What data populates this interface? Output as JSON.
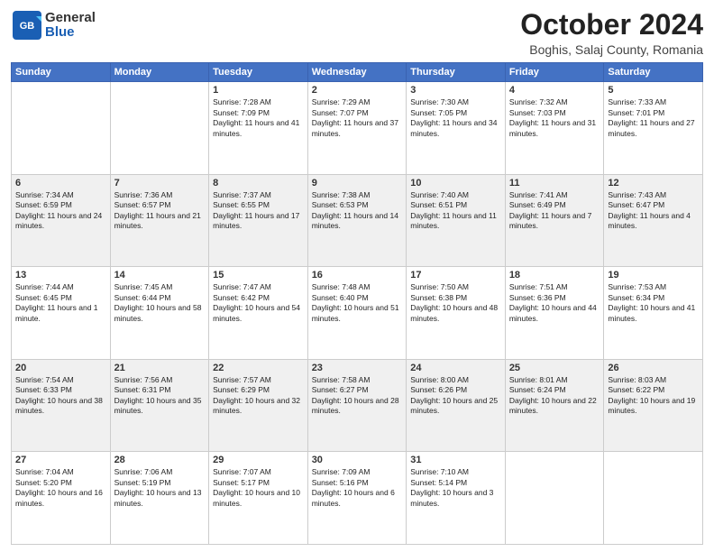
{
  "header": {
    "logo_line1": "General",
    "logo_line2": "Blue",
    "month_title": "October 2024",
    "location": "Boghis, Salaj County, Romania"
  },
  "days_of_week": [
    "Sunday",
    "Monday",
    "Tuesday",
    "Wednesday",
    "Thursday",
    "Friday",
    "Saturday"
  ],
  "weeks": [
    [
      {
        "day": "",
        "content": ""
      },
      {
        "day": "",
        "content": ""
      },
      {
        "day": "1",
        "content": "Sunrise: 7:28 AM\nSunset: 7:09 PM\nDaylight: 11 hours and 41 minutes."
      },
      {
        "day": "2",
        "content": "Sunrise: 7:29 AM\nSunset: 7:07 PM\nDaylight: 11 hours and 37 minutes."
      },
      {
        "day": "3",
        "content": "Sunrise: 7:30 AM\nSunset: 7:05 PM\nDaylight: 11 hours and 34 minutes."
      },
      {
        "day": "4",
        "content": "Sunrise: 7:32 AM\nSunset: 7:03 PM\nDaylight: 11 hours and 31 minutes."
      },
      {
        "day": "5",
        "content": "Sunrise: 7:33 AM\nSunset: 7:01 PM\nDaylight: 11 hours and 27 minutes."
      }
    ],
    [
      {
        "day": "6",
        "content": "Sunrise: 7:34 AM\nSunset: 6:59 PM\nDaylight: 11 hours and 24 minutes."
      },
      {
        "day": "7",
        "content": "Sunrise: 7:36 AM\nSunset: 6:57 PM\nDaylight: 11 hours and 21 minutes."
      },
      {
        "day": "8",
        "content": "Sunrise: 7:37 AM\nSunset: 6:55 PM\nDaylight: 11 hours and 17 minutes."
      },
      {
        "day": "9",
        "content": "Sunrise: 7:38 AM\nSunset: 6:53 PM\nDaylight: 11 hours and 14 minutes."
      },
      {
        "day": "10",
        "content": "Sunrise: 7:40 AM\nSunset: 6:51 PM\nDaylight: 11 hours and 11 minutes."
      },
      {
        "day": "11",
        "content": "Sunrise: 7:41 AM\nSunset: 6:49 PM\nDaylight: 11 hours and 7 minutes."
      },
      {
        "day": "12",
        "content": "Sunrise: 7:43 AM\nSunset: 6:47 PM\nDaylight: 11 hours and 4 minutes."
      }
    ],
    [
      {
        "day": "13",
        "content": "Sunrise: 7:44 AM\nSunset: 6:45 PM\nDaylight: 11 hours and 1 minute."
      },
      {
        "day": "14",
        "content": "Sunrise: 7:45 AM\nSunset: 6:44 PM\nDaylight: 10 hours and 58 minutes."
      },
      {
        "day": "15",
        "content": "Sunrise: 7:47 AM\nSunset: 6:42 PM\nDaylight: 10 hours and 54 minutes."
      },
      {
        "day": "16",
        "content": "Sunrise: 7:48 AM\nSunset: 6:40 PM\nDaylight: 10 hours and 51 minutes."
      },
      {
        "day": "17",
        "content": "Sunrise: 7:50 AM\nSunset: 6:38 PM\nDaylight: 10 hours and 48 minutes."
      },
      {
        "day": "18",
        "content": "Sunrise: 7:51 AM\nSunset: 6:36 PM\nDaylight: 10 hours and 44 minutes."
      },
      {
        "day": "19",
        "content": "Sunrise: 7:53 AM\nSunset: 6:34 PM\nDaylight: 10 hours and 41 minutes."
      }
    ],
    [
      {
        "day": "20",
        "content": "Sunrise: 7:54 AM\nSunset: 6:33 PM\nDaylight: 10 hours and 38 minutes."
      },
      {
        "day": "21",
        "content": "Sunrise: 7:56 AM\nSunset: 6:31 PM\nDaylight: 10 hours and 35 minutes."
      },
      {
        "day": "22",
        "content": "Sunrise: 7:57 AM\nSunset: 6:29 PM\nDaylight: 10 hours and 32 minutes."
      },
      {
        "day": "23",
        "content": "Sunrise: 7:58 AM\nSunset: 6:27 PM\nDaylight: 10 hours and 28 minutes."
      },
      {
        "day": "24",
        "content": "Sunrise: 8:00 AM\nSunset: 6:26 PM\nDaylight: 10 hours and 25 minutes."
      },
      {
        "day": "25",
        "content": "Sunrise: 8:01 AM\nSunset: 6:24 PM\nDaylight: 10 hours and 22 minutes."
      },
      {
        "day": "26",
        "content": "Sunrise: 8:03 AM\nSunset: 6:22 PM\nDaylight: 10 hours and 19 minutes."
      }
    ],
    [
      {
        "day": "27",
        "content": "Sunrise: 7:04 AM\nSunset: 5:20 PM\nDaylight: 10 hours and 16 minutes."
      },
      {
        "day": "28",
        "content": "Sunrise: 7:06 AM\nSunset: 5:19 PM\nDaylight: 10 hours and 13 minutes."
      },
      {
        "day": "29",
        "content": "Sunrise: 7:07 AM\nSunset: 5:17 PM\nDaylight: 10 hours and 10 minutes."
      },
      {
        "day": "30",
        "content": "Sunrise: 7:09 AM\nSunset: 5:16 PM\nDaylight: 10 hours and 6 minutes."
      },
      {
        "day": "31",
        "content": "Sunrise: 7:10 AM\nSunset: 5:14 PM\nDaylight: 10 hours and 3 minutes."
      },
      {
        "day": "",
        "content": ""
      },
      {
        "day": "",
        "content": ""
      }
    ]
  ]
}
